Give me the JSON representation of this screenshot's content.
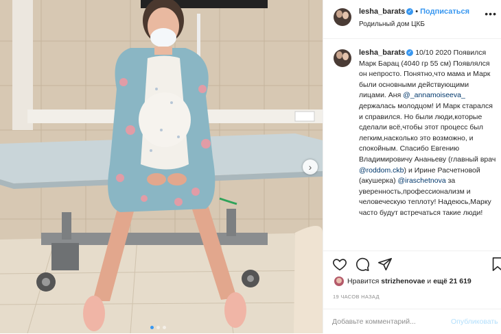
{
  "post": {
    "photo_alt": "",
    "carousel_dots": 3,
    "active_dot": 0
  },
  "header": {
    "username": "lesha_barats",
    "separator": "•",
    "follow_label": "Подписаться",
    "location": "Родильный дом ЦКБ",
    "more_icon": "more-horizontal-icon"
  },
  "caption": {
    "username": "lesha_barats",
    "text_1": "10/10 2020 Появился Марк Барац (4040 гр 55 см) Появлялся он непросто. Понятно,что мама и Марк были основными действующими лицами. Аня ",
    "mention_1": "@_annamoiseeva_",
    "text_2": " держалась молодцом! И Марк старался и справился. Но были люди,которые сделали всё,чтобы этот процесс был легким,насколько это возможно, и спокойным. Спасибо Евгению Владимировичу Ананьеву (главный врач ",
    "mention_2": "@roddom.ckb",
    "text_3": ") и Ирине Расчетновой (акушерка) ",
    "mention_3": "@iraschetnova",
    "text_4": " за уверенность,профессионализм и человеческую теплоту! Надеюсь,Марку часто будут встречаться такие люди!"
  },
  "actions": {
    "icons": [
      "heart-icon",
      "comment-icon",
      "share-icon",
      "bookmark-icon"
    ]
  },
  "likes": {
    "prefix": "Нравится",
    "user": "strizhenovae",
    "middle": "и",
    "count": "ещё 21 619"
  },
  "timestamp": "19 ЧАСОВ НАЗАД",
  "comment_box": {
    "placeholder": "Добавьте комментарий...",
    "publish_label": "Опубликовать"
  },
  "colors": {
    "accent": "#3897f0",
    "mention": "#00376b",
    "muted": "#8e8e8e",
    "publish_disabled": "#b2dffc"
  }
}
